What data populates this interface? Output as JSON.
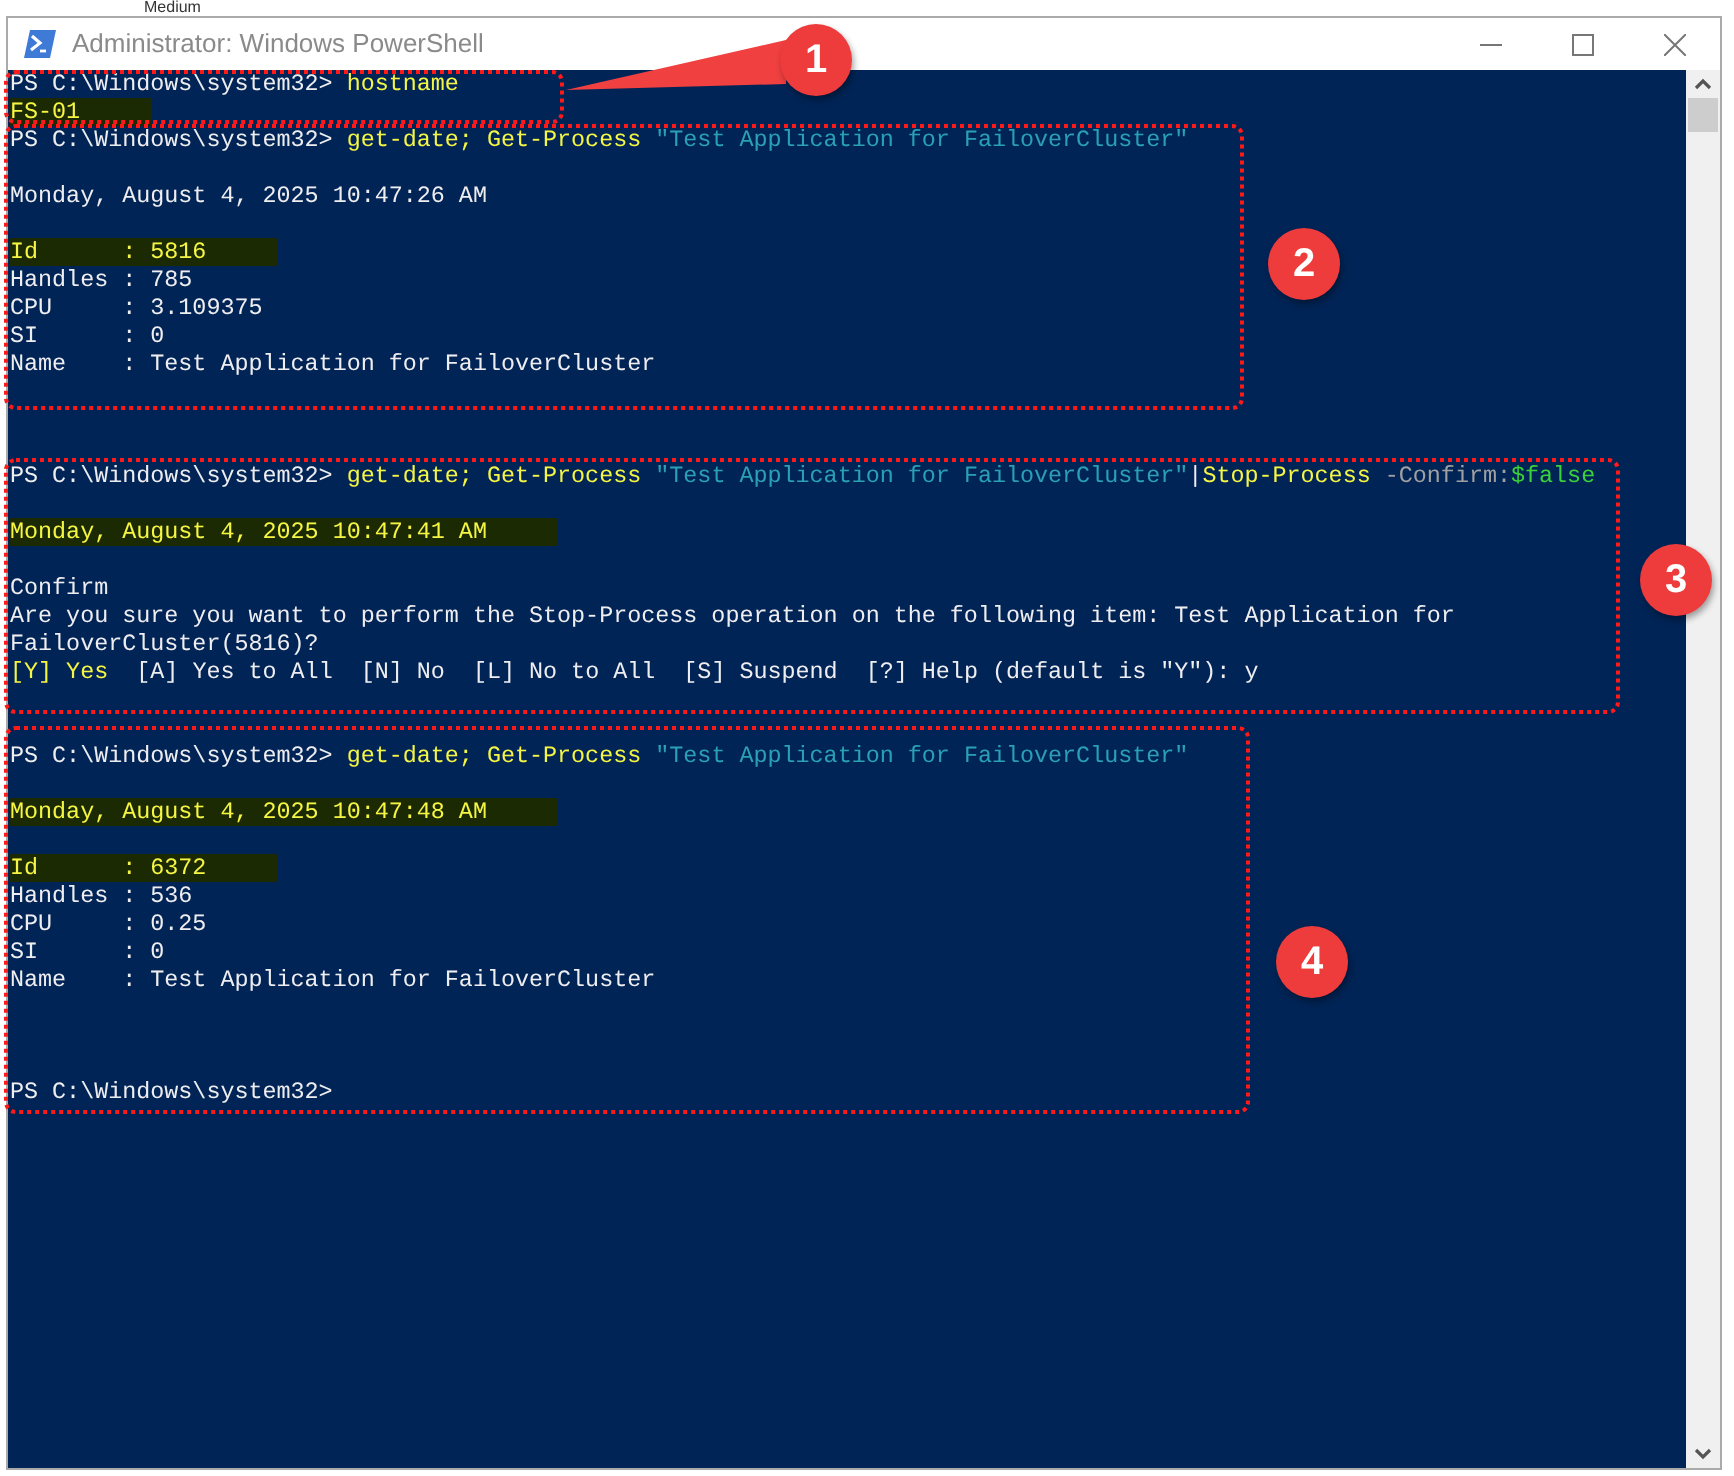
{
  "background_label": "Medium",
  "window": {
    "title": "Administrator: Windows PowerShell"
  },
  "console": {
    "lines": [
      {
        "kind": "text",
        "segments": [
          {
            "kind": "prompt",
            "text": "PS C:\\Windows\\system32> "
          },
          {
            "kind": "command",
            "text": "hostname"
          }
        ]
      },
      {
        "kind": "text",
        "highlighted": true,
        "segments": [
          {
            "kind": "output",
            "text": "FS-01"
          }
        ]
      },
      {
        "kind": "text",
        "segments": [
          {
            "kind": "prompt",
            "text": "PS C:\\Windows\\system32> "
          },
          {
            "kind": "command",
            "text": "get-date; Get-Process "
          },
          {
            "kind": "string",
            "text": "\"Test Application for FailoverCluster\""
          }
        ]
      },
      {
        "kind": "blank"
      },
      {
        "kind": "text",
        "segments": [
          {
            "kind": "output",
            "text": "Monday, August 4, 2025 10:47:26 AM"
          }
        ]
      },
      {
        "kind": "blank"
      },
      {
        "kind": "text",
        "highlighted": true,
        "segments": [
          {
            "kind": "output",
            "text": "Id      : 5816"
          }
        ]
      },
      {
        "kind": "text",
        "segments": [
          {
            "kind": "output",
            "text": "Handles : 785"
          }
        ]
      },
      {
        "kind": "text",
        "segments": [
          {
            "kind": "output",
            "text": "CPU     : 3.109375"
          }
        ]
      },
      {
        "kind": "text",
        "segments": [
          {
            "kind": "output",
            "text": "SI      : 0"
          }
        ]
      },
      {
        "kind": "text",
        "segments": [
          {
            "kind": "output",
            "text": "Name    : Test Application for FailoverCluster"
          }
        ]
      },
      {
        "kind": "blank"
      },
      {
        "kind": "blank"
      },
      {
        "kind": "blank"
      },
      {
        "kind": "text",
        "segments": [
          {
            "kind": "prompt",
            "text": "PS C:\\Windows\\system32> "
          },
          {
            "kind": "command",
            "text": "get-date; Get-Process "
          },
          {
            "kind": "string",
            "text": "\"Test Application for FailoverCluster\""
          },
          {
            "kind": "prompt",
            "text": "|"
          },
          {
            "kind": "command",
            "text": "Stop-Process "
          },
          {
            "kind": "param",
            "text": "-Confirm:"
          },
          {
            "kind": "variable",
            "text": "$false"
          }
        ]
      },
      {
        "kind": "blank"
      },
      {
        "kind": "text",
        "highlighted": true,
        "segments": [
          {
            "kind": "output",
            "text": "Monday, August 4, 2025 10:47:41 AM"
          }
        ]
      },
      {
        "kind": "blank"
      },
      {
        "kind": "text",
        "segments": [
          {
            "kind": "output",
            "text": "Confirm"
          }
        ]
      },
      {
        "kind": "text",
        "segments": [
          {
            "kind": "output",
            "text": "Are you sure you want to perform the Stop-Process operation on the following item: Test Application for"
          }
        ]
      },
      {
        "kind": "text",
        "segments": [
          {
            "kind": "output",
            "text": "FailoverCluster(5816)?"
          }
        ]
      },
      {
        "kind": "text",
        "segments": [
          {
            "kind": "command",
            "text": "[Y] Yes"
          },
          {
            "kind": "output",
            "text": "  [A] Yes to All  [N] No  [L] No to All  [S] Suspend  [?] Help (default is \"Y\"): y"
          }
        ]
      },
      {
        "kind": "blank"
      },
      {
        "kind": "blank"
      },
      {
        "kind": "text",
        "segments": [
          {
            "kind": "prompt",
            "text": "PS C:\\Windows\\system32> "
          },
          {
            "kind": "command",
            "text": "get-date; Get-Process "
          },
          {
            "kind": "string",
            "text": "\"Test Application for FailoverCluster\""
          }
        ]
      },
      {
        "kind": "blank"
      },
      {
        "kind": "text",
        "highlighted": true,
        "segments": [
          {
            "kind": "output",
            "text": "Monday, August 4, 2025 10:47:48 AM"
          }
        ]
      },
      {
        "kind": "blank"
      },
      {
        "kind": "text",
        "highlighted": true,
        "segments": [
          {
            "kind": "output",
            "text": "Id      : 6372"
          }
        ]
      },
      {
        "kind": "text",
        "segments": [
          {
            "kind": "output",
            "text": "Handles : 536"
          }
        ]
      },
      {
        "kind": "text",
        "segments": [
          {
            "kind": "output",
            "text": "CPU     : 0.25"
          }
        ]
      },
      {
        "kind": "text",
        "segments": [
          {
            "kind": "output",
            "text": "SI      : 0"
          }
        ]
      },
      {
        "kind": "text",
        "segments": [
          {
            "kind": "output",
            "text": "Name    : Test Application for FailoverCluster"
          }
        ]
      },
      {
        "kind": "blank"
      },
      {
        "kind": "blank"
      },
      {
        "kind": "blank"
      },
      {
        "kind": "text",
        "segments": [
          {
            "kind": "prompt",
            "text": "PS C:\\Windows\\system32>"
          }
        ]
      }
    ]
  },
  "callouts": [
    {
      "label": "1"
    },
    {
      "label": "2"
    },
    {
      "label": "3"
    },
    {
      "label": "4"
    }
  ]
}
